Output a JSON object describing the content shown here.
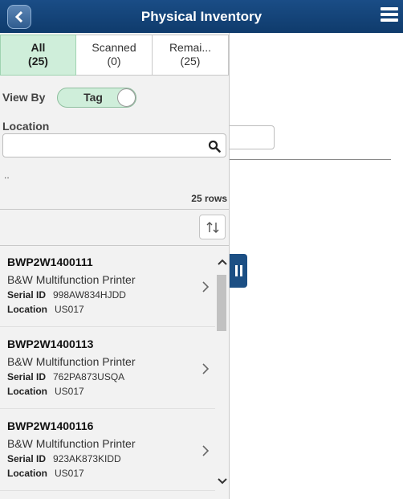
{
  "header": {
    "title": "Physical Inventory",
    "back_icon": "chevron-left-icon",
    "menu_icon": "hamburger-menu-icon"
  },
  "tabs": [
    {
      "label": "All",
      "count": "(25)",
      "active": true
    },
    {
      "label": "Scanned",
      "count": "(0)",
      "active": false
    },
    {
      "label": "Remai...",
      "count": "(25)",
      "active": false
    }
  ],
  "view_by": {
    "label": "View By",
    "toggle_value": "Tag"
  },
  "location": {
    "label": "Location",
    "value": "",
    "placeholder": ""
  },
  "dots_text": "..",
  "rows_count": "25 rows",
  "items": [
    {
      "tag": "BWP2W1400111",
      "description": "B&W Multifunction Printer",
      "serial_label": "Serial ID",
      "serial": "998AW834HJDD",
      "location_label": "Location",
      "location": "US017"
    },
    {
      "tag": "BWP2W1400113",
      "description": "B&W Multifunction Printer",
      "serial_label": "Serial ID",
      "serial": "762PA873USQA",
      "location_label": "Location",
      "location": "US017"
    },
    {
      "tag": "BWP2W1400116",
      "description": "B&W Multifunction Printer",
      "serial_label": "Serial ID",
      "serial": "923AK873KIDD",
      "location_label": "Location",
      "location": "US017"
    }
  ],
  "colors": {
    "header": "#15457a",
    "active_tab": "#cfeeda",
    "panel_bg": "#f2f2f2"
  }
}
